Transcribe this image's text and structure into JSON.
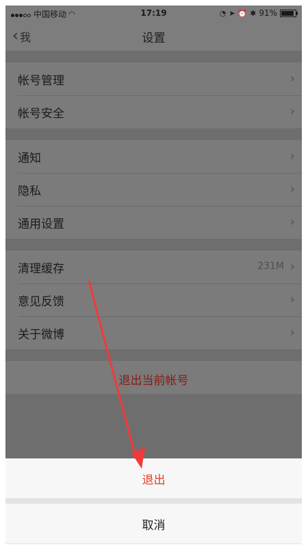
{
  "status_bar": {
    "carrier": "中国移动",
    "time": "17:19",
    "battery": "91%",
    "battery_level": 0.91
  },
  "nav": {
    "back_label": "我",
    "title": "设置"
  },
  "groups": [
    {
      "rows": [
        {
          "label": "帐号管理"
        },
        {
          "label": "帐号安全"
        }
      ]
    },
    {
      "rows": [
        {
          "label": "通知"
        },
        {
          "label": "隐私"
        },
        {
          "label": "通用设置"
        }
      ]
    },
    {
      "rows": [
        {
          "label": "清理缓存",
          "value": "231M"
        },
        {
          "label": "意见反馈"
        },
        {
          "label": "关于微博"
        }
      ]
    }
  ],
  "logout_label": "退出当前帐号",
  "action_sheet": {
    "exit_label": "退出",
    "cancel_label": "取消"
  },
  "colors": {
    "annotation_arrow": "#f23a3a",
    "destructive": "#e23f2e"
  }
}
